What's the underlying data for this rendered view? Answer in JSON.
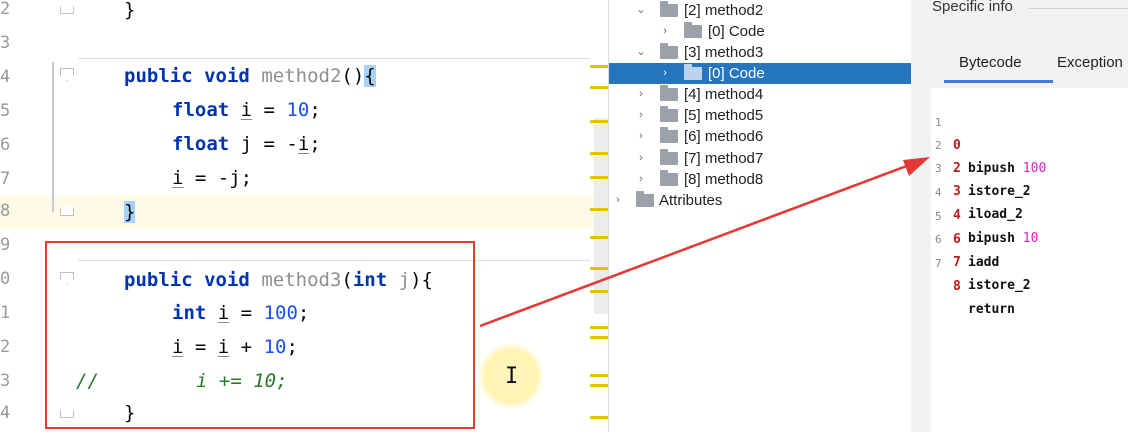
{
  "editor": {
    "line_numbers": [
      "2",
      "3",
      "4",
      "5",
      "6",
      "7",
      "8",
      "9",
      "0",
      "1",
      "2",
      "3",
      "4"
    ],
    "lines": {
      "l2_brace": "}",
      "l4_kw1": "public",
      "l4_kw2": "void",
      "l4_name": "method2",
      "l4_paren": "()",
      "l4_brace": "{",
      "l5_kw": "float",
      "l5_var": "i",
      "l5_eq": " = ",
      "l5_num": "10",
      "l5_semi": ";",
      "l6_kw": "float",
      "l6_rest": " j = -",
      "l6_var": "i",
      "l6_semi": ";",
      "l7_var": "i",
      "l7_rest": " = -j;",
      "l8_brace": "}",
      "l10_kw1": "public",
      "l10_kw2": "void",
      "l10_name": "method3",
      "l10_open": "(",
      "l10_kw3": "int",
      "l10_param": "j",
      "l10_close": "){",
      "l11_kw": "int",
      "l11_var": "i",
      "l11_eq": " = ",
      "l11_num": "100",
      "l11_semi": ";",
      "l12_var1": "i",
      "l12_eq": " = ",
      "l12_var2": "i",
      "l12_plus": " + ",
      "l12_num": "10",
      "l12_semi": ";",
      "l13_slash": "//",
      "l13_code": "i += 10;",
      "l14_brace": "}"
    },
    "cursor_glyph": "I"
  },
  "tree": {
    "items": [
      {
        "label": "[2] method2",
        "chevron": "⌄"
      },
      {
        "label": "[0] Code",
        "chevron": "›"
      },
      {
        "label": "[3] method3",
        "chevron": "⌄"
      },
      {
        "label": "[0] Code",
        "chevron": "›"
      },
      {
        "label": "[4] method4",
        "chevron": "›"
      },
      {
        "label": "[5] method5",
        "chevron": "›"
      },
      {
        "label": "[6] method6",
        "chevron": "›"
      },
      {
        "label": "[7] method7",
        "chevron": "›"
      },
      {
        "label": "[8] method8",
        "chevron": "›"
      },
      {
        "label": "Attributes",
        "chevron": "›"
      }
    ],
    "selected_color": "#2675bf"
  },
  "info": {
    "title": "Specific info",
    "tabs": [
      "Bytecode",
      "Exception"
    ],
    "bytecode": [
      {
        "idx": "1",
        "offset": "0",
        "op": "bipush",
        "arg": "100"
      },
      {
        "idx": "2",
        "offset": "2",
        "op": "istore_2",
        "arg": ""
      },
      {
        "idx": "3",
        "offset": "3",
        "op": "iload_2",
        "arg": ""
      },
      {
        "idx": "4",
        "offset": "4",
        "op": "bipush",
        "arg": "10"
      },
      {
        "idx": "5",
        "offset": "6",
        "op": "iadd",
        "arg": ""
      },
      {
        "idx": "6",
        "offset": "7",
        "op": "istore_2",
        "arg": ""
      },
      {
        "idx": "7",
        "offset": "8",
        "op": "return",
        "arg": ""
      }
    ]
  },
  "colors": {
    "annotation_red": "#e53935",
    "keyword": "#0033b3",
    "number": "#1750eb",
    "comment": "#287a28"
  }
}
